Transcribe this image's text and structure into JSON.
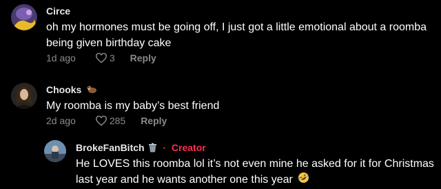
{
  "comments": [
    {
      "username": "Circe",
      "text": "oh my hormones must be going off, I just got a little emotional about a roomba being given birthday cake",
      "age": "1d ago",
      "likes": "3",
      "reply_label": "Reply"
    },
    {
      "username": "Chooks",
      "username_emoji": "otter-emoji",
      "text": "My roomba is my baby’s best friend",
      "age": "2d ago",
      "likes": "285",
      "reply_label": "Reply"
    }
  ],
  "reply": {
    "username": "BrokeFanBitch",
    "username_emoji": "trash-can-emoji",
    "separator": "·",
    "creator_label": "Creator",
    "text": "He LOVES this roomba lol it’s not even mine he asked for it for Christmas last year and he wants another one this year",
    "text_emoji": "rolling-on-floor-laughing-emoji"
  },
  "colors": {
    "background": "#000000",
    "meta_gray": "#8a8a8a",
    "creator_red": "#fe2c55"
  }
}
